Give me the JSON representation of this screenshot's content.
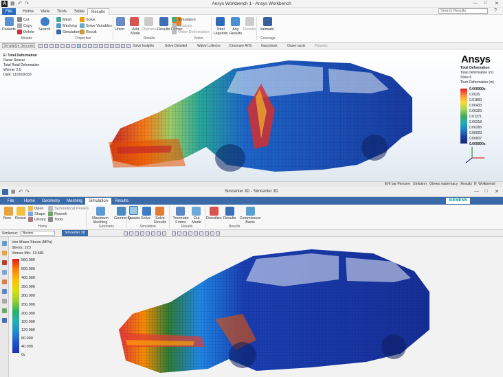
{
  "ansys": {
    "window_title": "Ansys Workbench 1 - Ansys Workbench",
    "tabs": [
      "File",
      "Home",
      "View",
      "Tools",
      "Solve",
      "Results"
    ],
    "active_tab": "Results",
    "search_placeholder": "Search Results",
    "ribbon": {
      "outline": {
        "parasits": "Parasits",
        "cut": "Cut",
        "copy": "Copy",
        "delete": "Delete",
        "search": "Search",
        "group": "Minade"
      },
      "properties": {
        "mesh": "Mesh",
        "meshing": "Meshing",
        "simulation": "Simulation",
        "solve": "Solve",
        "solve_variables": "Solve Variables",
        "result": "Result",
        "group": "Properties"
      },
      "results": {
        "union": "Union",
        "add_mode": "Add Mode",
        "chenses": "Chenses",
        "results": "Results",
        "defoer": "Defoer",
        "group": "Results"
      },
      "solve": {
        "simulation": "Simulation",
        "analysis": "Analysis",
        "order_deformation": "Order Deformation",
        "group": "Solve"
      },
      "coverage": {
        "total_legends": "Total Legends",
        "any_results": "Any Results",
        "results": "Results",
        "valmiats": "Valmiats",
        "group": "Coverage"
      }
    },
    "toolbar": {
      "dropdown": "Simulation Geouree",
      "items": [
        "Solve Insights",
        "Solve Detailed",
        "Walve Lollector",
        "Cirunnare AHS",
        "Gacostock",
        "Ouser assis",
        "Paranes"
      ]
    },
    "info": {
      "title": "E: Total Deformation",
      "l1": "Runar Reazar",
      "l2": "Total Rotal Deformation",
      "l3": "Wonne: 2.0",
      "l4": "Date: 11/2018/333"
    },
    "logo": "Ansys",
    "legend": {
      "h1": "Total Deformation",
      "h2": "Total Deformation (m)",
      "h3": "Stree 6",
      "h4": "Tlure Deformation (m)",
      "values": [
        "0.000000s",
        "0.0025",
        "0.01800",
        "0.00433",
        "0.00323",
        "0.01371",
        "0.00318",
        "0.00265",
        "0.00023",
        "0.00007",
        "0.000000s"
      ]
    },
    "status": [
      "EHI bar Persone",
      "Stritutinn",
      "Gtrees matermacy",
      "Results",
      "Ill",
      "Wolkbenoli"
    ]
  },
  "simcenter": {
    "window_title": "Simcenter 3D - Simcenter 3D",
    "tabs": [
      "File",
      "Home",
      "Geometry",
      "Meshing",
      "Simulation",
      "Results"
    ],
    "active_tab": "Simulation",
    "brand": "SIEMENS",
    "ribbon": {
      "home": {
        "new": "New",
        "reuse": "Reuse",
        "open": "Open",
        "shape": "Shape",
        "library": "Library",
        "rework": "Rework",
        "tools": "Tools",
        "symmetrical": "Symmetrical Pesses",
        "group": "Home"
      },
      "geometry": {
        "maximum_meshing": "Maximum Meshing",
        "geometry": "Geometry",
        "group": "Geometry"
      },
      "simulation": {
        "tarasts": "Tarasts",
        "solve": "Solve",
        "solve_results": "Solve Results",
        "group": "Simulation"
      },
      "results": {
        "treemate_forms": "Treemate Forms",
        "out_mode": "Out Mode",
        "group": "Results"
      },
      "results2": {
        "densities": "Densities",
        "results": "Results",
        "commissure_basis": "Commissure Basis",
        "group": "Results"
      }
    },
    "toolbar": {
      "label": "Simlurour:",
      "dropdown": "Booms",
      "file_tab": "Simcenter 3D"
    },
    "info": {
      "title": "Von Mises Stress (MPa)",
      "l1": "Stress: 223",
      "l2": "Vomas Mis- 13.581"
    },
    "legend": {
      "values": [
        "560.000",
        "500.000",
        "400.000",
        "350.000",
        "300.000",
        "250.000",
        "200.000",
        "160.000",
        "120.000",
        "60.000",
        "40.000",
        "0y"
      ]
    }
  }
}
